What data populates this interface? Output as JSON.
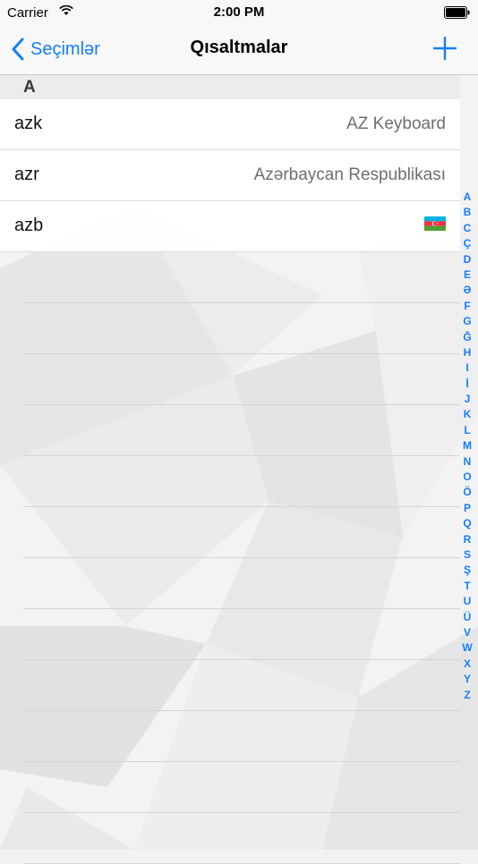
{
  "status_bar": {
    "carrier": "Carrier",
    "time": "2:00 PM"
  },
  "nav": {
    "back_label": "Seçimlər",
    "title": "Qısaltmalar"
  },
  "section": {
    "letter": "A"
  },
  "rows": [
    {
      "key": "azk",
      "value": "AZ Keyboard"
    },
    {
      "key": "azr",
      "value": "Azərbaycan Respublikası"
    },
    {
      "key": "azb",
      "value": ""
    }
  ],
  "index_letters": [
    "A",
    "B",
    "C",
    "Ç",
    "D",
    "E",
    "Ə",
    "F",
    "G",
    "Ğ",
    "H",
    "I",
    "İ",
    "J",
    "K",
    "L",
    "M",
    "N",
    "O",
    "Ö",
    "P",
    "Q",
    "R",
    "S",
    "Ş",
    "T",
    "U",
    "Ü",
    "V",
    "W",
    "X",
    "Y",
    "Z"
  ],
  "colors": {
    "accent": "#147efb",
    "flag_blue": "#00b5e2",
    "flag_red": "#ef3340",
    "flag_green": "#509e2f"
  }
}
